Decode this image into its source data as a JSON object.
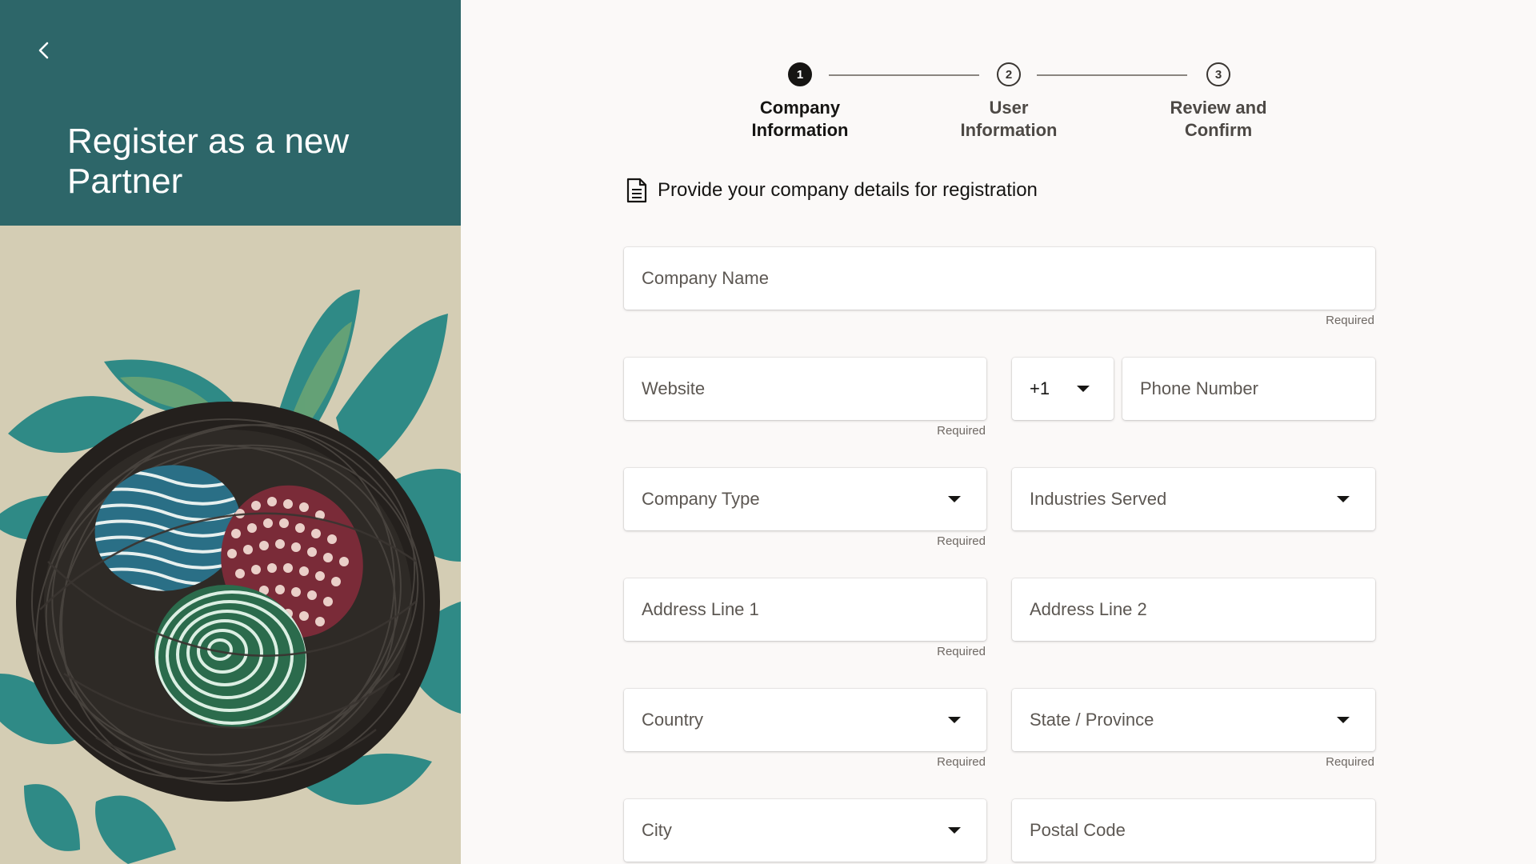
{
  "left_panel": {
    "title": "Register as a new Partner",
    "back_icon": "chevron-left-icon",
    "colors": {
      "header_bg": "#2d6669",
      "illustration_bg": "#d8d1b8",
      "leaf": "#2f8a86",
      "nest": "#2a2623"
    }
  },
  "stepper": {
    "steps": [
      {
        "number": "1",
        "label": "Company Information",
        "state": "active"
      },
      {
        "number": "2",
        "label": "User Information",
        "state": "pending"
      },
      {
        "number": "3",
        "label": "Review and Confirm",
        "state": "pending"
      }
    ]
  },
  "form": {
    "heading": "Provide your company details for registration",
    "heading_icon": "document-icon",
    "fields": {
      "company_name": {
        "placeholder": "Company Name",
        "helper": "Required"
      },
      "website": {
        "placeholder": "Website",
        "helper": "Required"
      },
      "country_code": {
        "value": "+1"
      },
      "phone_number": {
        "placeholder": "Phone Number"
      },
      "company_type": {
        "placeholder": "Company Type",
        "helper": "Required"
      },
      "industries_served": {
        "placeholder": "Industries Served"
      },
      "address_line_1": {
        "placeholder": "Address Line 1",
        "helper": "Required"
      },
      "address_line_2": {
        "placeholder": "Address Line 2"
      },
      "country": {
        "placeholder": "Country",
        "helper": "Required"
      },
      "state_province": {
        "placeholder": "State / Province",
        "helper": "Required"
      },
      "city": {
        "placeholder": "City"
      },
      "postal_code": {
        "placeholder": "Postal Code"
      }
    }
  }
}
